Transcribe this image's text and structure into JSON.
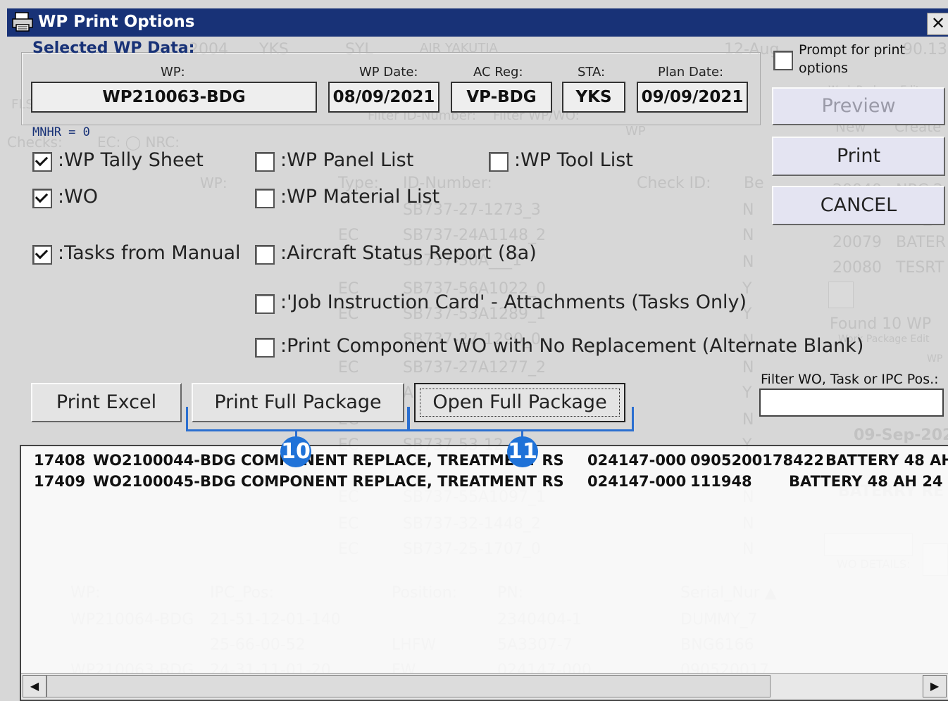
{
  "window": {
    "title": "WP Print Options",
    "close_glyph": "✕"
  },
  "selected": {
    "heading": "Selected WP Data:",
    "wp_label": "WP:",
    "wp_value": "WP210063-BDG",
    "wp_date_label": "WP Date:",
    "wp_date_value": "08/09/2021",
    "ac_reg_label": "AC Reg:",
    "ac_reg_value": "VP-BDG",
    "sta_label": "STA:",
    "sta_value": "YKS",
    "plan_date_label": "Plan Date:",
    "plan_date_value": "09/09/2021"
  },
  "prompt_print": {
    "checked": false,
    "label_line1": "Prompt for print",
    "label_line2": "options"
  },
  "mnhr": "MNHR = 0",
  "checkboxes": {
    "wp_tally": {
      "label": ":WP Tally Sheet",
      "checked": true
    },
    "wo": {
      "label": ":WO",
      "checked": true
    },
    "tasks_manual": {
      "label": ":Tasks from Manual",
      "checked": true
    },
    "wp_panel": {
      "label": ":WP Panel List",
      "checked": false
    },
    "wp_material": {
      "label": ":WP Material List",
      "checked": false
    },
    "ac_status": {
      "label": ":Aircraft Status Report (8a)",
      "checked": false
    },
    "job_instruction": {
      "label": ":'Job Instruction Card' - Attachments (Tasks Only)",
      "checked": false
    },
    "print_component": {
      "label": ":Print Component WO with No Replacement (Alternate Blank)",
      "checked": false
    },
    "wp_tool": {
      "label": ":WP Tool List",
      "checked": false
    }
  },
  "buttons": {
    "preview": "Preview",
    "print": "Print",
    "cancel": "CANCEL",
    "print_excel": "Print Excel",
    "print_full": "Print Full Package",
    "open_full": "Open Full Package"
  },
  "filter": {
    "label": "Filter WO, Task or IPC Pos.:",
    "value": ""
  },
  "annotations": {
    "badge_10": "10",
    "badge_11": "11",
    "accent": "#1f72d8"
  },
  "list_rows": [
    {
      "id": "17408",
      "wo": "WO2100044-BDG",
      "desc": "COMPONENT REPLACE, TREATMENT RS",
      "pn": "024147-000",
      "serial": "0905200178422",
      "name": "BATTERY 48 AH"
    },
    {
      "id": "17409",
      "wo": "WO2100045-BDG",
      "desc": "COMPONENT REPLACE, TREATMENT RS",
      "pn": "024147-000",
      "serial": "111948",
      "name": "BATTERY 48 AH 24"
    }
  ],
  "scrollbar": {
    "left_arrow": "◀",
    "right_arrow": "▶"
  }
}
